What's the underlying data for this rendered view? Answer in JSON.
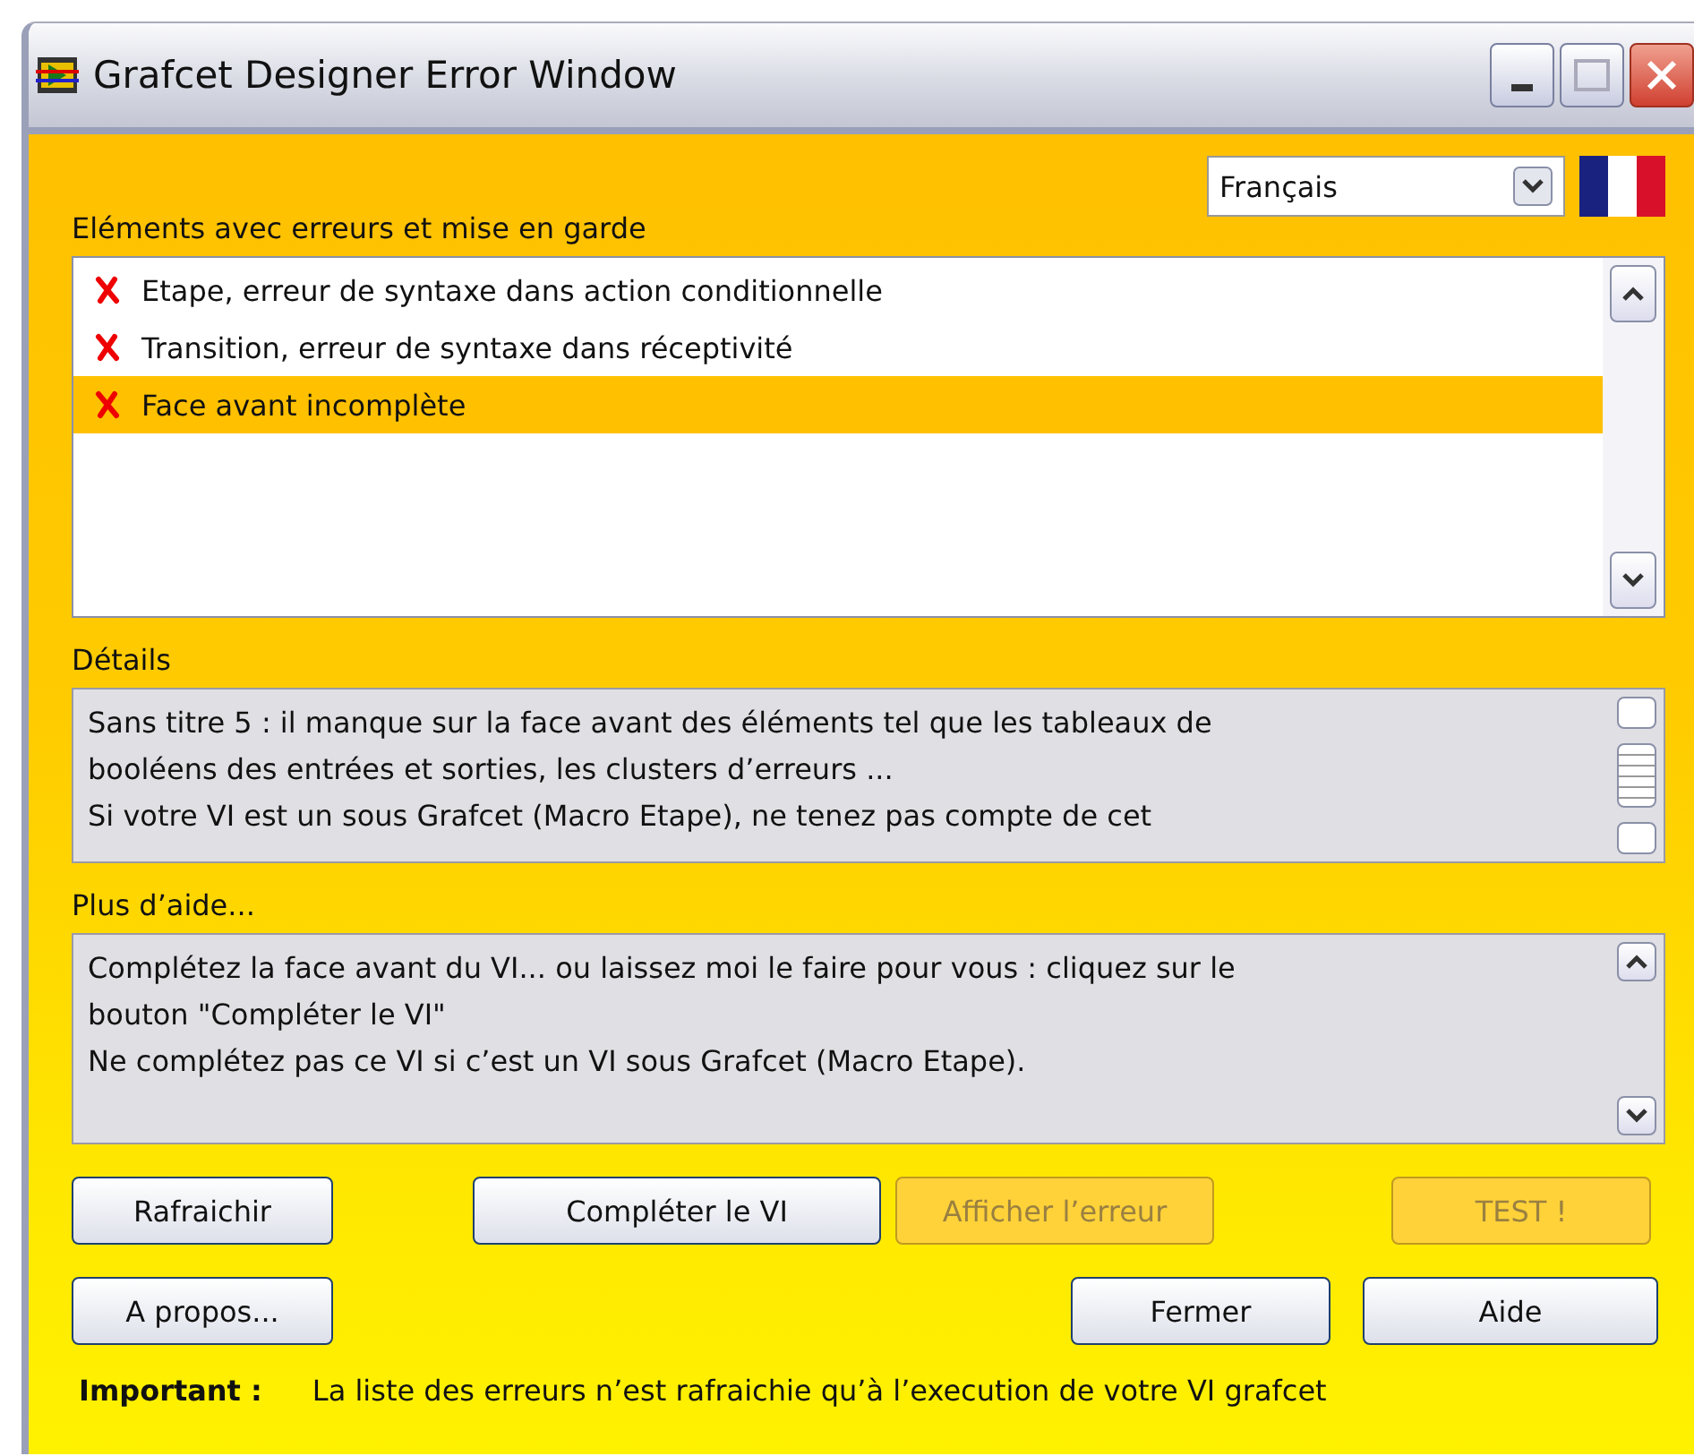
{
  "window": {
    "title": "Grafcet Designer Error Window"
  },
  "language": {
    "value": "Français"
  },
  "errors_list": {
    "label": "Eléments avec erreurs et mise en garde",
    "items": [
      {
        "text": "Etape, erreur de syntaxe dans action conditionnelle",
        "selected": false
      },
      {
        "text": "Transition, erreur de syntaxe dans réceptivité",
        "selected": false
      },
      {
        "text": "Face avant incomplète",
        "selected": true
      }
    ]
  },
  "details": {
    "label": "Détails",
    "lines": [
      "Sans titre 5 : il manque sur la face avant des éléments tel que les tableaux de",
      "booléens des entrées et sorties, les clusters d’erreurs ...",
      "Si votre VI est un sous Grafcet (Macro Etape), ne tenez pas compte de cet"
    ]
  },
  "help": {
    "label": "Plus d’aide...",
    "lines": [
      "Complétez la face avant du VI... ou laissez moi le faire pour vous : cliquez sur le",
      "bouton \"Compléter le VI\"",
      "Ne complétez pas ce VI si c’est un VI sous Grafcet (Macro Etape)."
    ]
  },
  "buttons_row_1": [
    {
      "label": "Rafraichir",
      "disabled": false
    },
    {
      "label": "Compléter le VI",
      "disabled": false
    },
    {
      "label": "Afficher l’erreur",
      "disabled": true
    },
    {
      "label": "TEST !",
      "disabled": true
    }
  ],
  "buttons_row_2": [
    {
      "label": "A propos...",
      "disabled": false
    },
    {
      "label": "Fermer",
      "disabled": false
    },
    {
      "label": "Aide",
      "disabled": false
    }
  ],
  "footer": {
    "label": "Important :",
    "text": "La liste des erreurs n’est rafraichie qu’à l’execution de votre VI grafcet"
  }
}
